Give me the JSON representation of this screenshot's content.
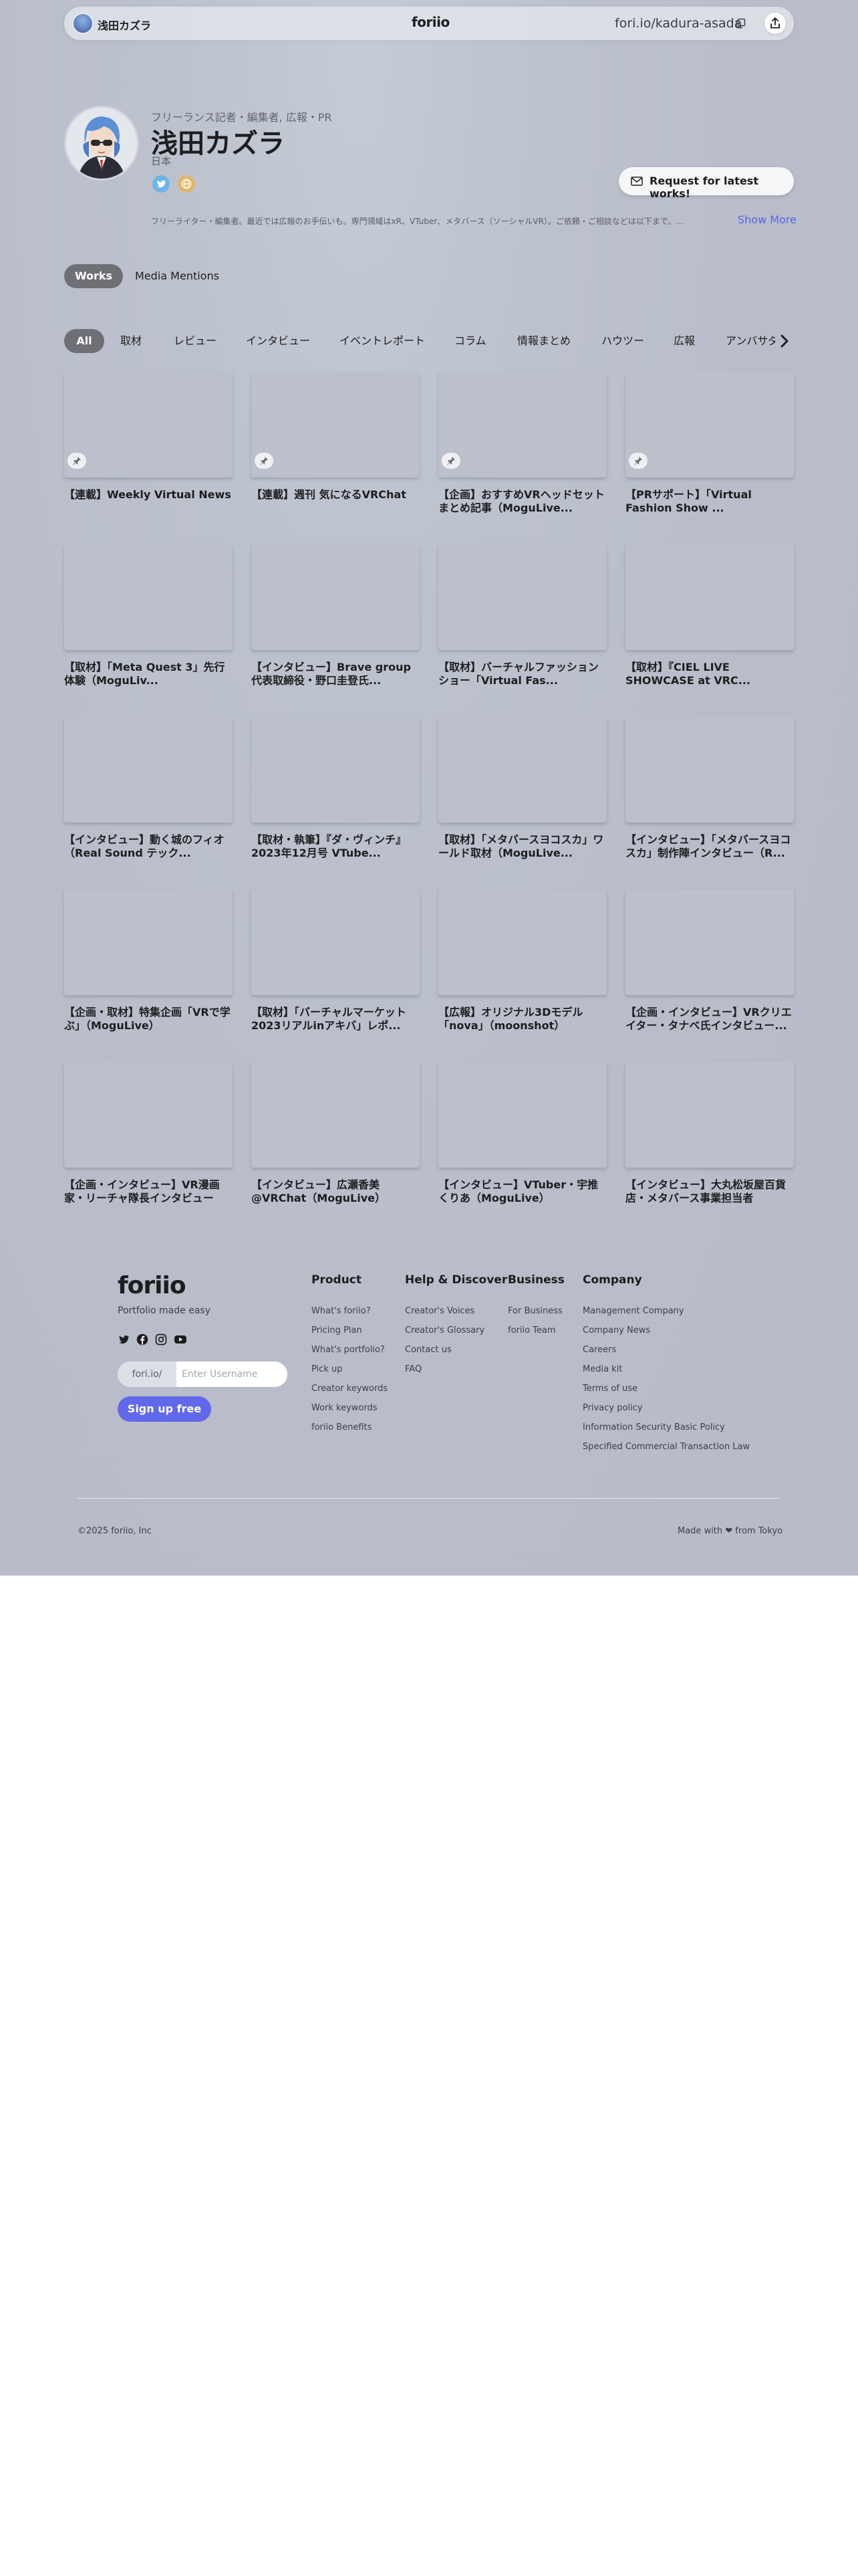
{
  "header": {
    "name": "浅田カズラ",
    "logo": "foriio",
    "url": "fori.io/kadura-asada",
    "copy_icon": "copy-icon",
    "share_icon": "share-icon"
  },
  "profile": {
    "occupation": "フリーランス記者・編集者, 広報・PR",
    "name": "浅田カズラ",
    "location": "日本",
    "socials": [
      "twitter-icon",
      "website-icon"
    ],
    "request_button": "Request for latest works!",
    "bio": "フリーライター・編集者。最近では広報のお手伝いも。専門領域はxR、VTuber、メタバース（ソーシャルVR）。ご依頼・ご相談などは以下まで。…",
    "show_more": "Show More"
  },
  "main_tabs": [
    {
      "label": "Works",
      "active": true
    },
    {
      "label": "Media Mentions",
      "active": false
    }
  ],
  "categories": [
    "All",
    "取材",
    "レビュー",
    "インタビュー",
    "イベントレポート",
    "コラム",
    "情報まとめ",
    "ハウツー",
    "広報",
    "アンバサダー"
  ],
  "works": [
    {
      "title": "【連載】Weekly Virtual News",
      "pinned": true
    },
    {
      "title": "【連載】週刊 気になるVRChat",
      "pinned": true
    },
    {
      "title": "【企画】おすすめVRヘッドセットまとめ記事（MoguLive...",
      "pinned": true
    },
    {
      "title": "【PRサポート】「Virtual Fashion Show ...",
      "pinned": true
    },
    {
      "title": "【取材】「Meta Quest 3」先行体験（MoguLiv...",
      "pinned": false
    },
    {
      "title": "【インタビュー】Brave group代表取締役・野口圭登氏...",
      "pinned": false
    },
    {
      "title": "【取材】バーチャルファッションショー「Virtual Fas...",
      "pinned": false
    },
    {
      "title": "【取材】『CIEL LIVE SHOWCASE at VRC...",
      "pinned": false
    },
    {
      "title": "【インタビュー】動く城のフィオ（Real Sound テック...",
      "pinned": false
    },
    {
      "title": "【取材・執筆】『ダ・ヴィンチ』2023年12月号 VTube...",
      "pinned": false
    },
    {
      "title": "【取材】「メタバースヨコスカ」ワールド取材（MoguLive...",
      "pinned": false
    },
    {
      "title": "【インタビュー】「メタバースヨコスカ」制作陣インタビュー（R...",
      "pinned": false
    },
    {
      "title": "【企画・取材】特集企画「VRで学ぶ」（MoguLive）",
      "pinned": false
    },
    {
      "title": "【取材】「バーチャルマーケット2023リアルinアキバ」レポ...",
      "pinned": false
    },
    {
      "title": "【広報】オリジナル3Dモデル「nova」（moonshot）",
      "pinned": false
    },
    {
      "title": "【企画・インタビュー】VRクリエイター・タナベ氏インタビュー...",
      "pinned": false
    },
    {
      "title": "【企画・インタビュー】VR漫画家・リーチャ隊長インタビュー（...",
      "pinned": false
    },
    {
      "title": "【インタビュー】広瀬香美@VRChat（MoguLive）",
      "pinned": false
    },
    {
      "title": "【インタビュー】VTuber・宇推くりあ（MoguLive）",
      "pinned": false
    },
    {
      "title": "【インタビュー】大丸松坂屋百貨店・メタバース事業担当者（Mo...",
      "pinned": false
    }
  ],
  "footer": {
    "logo": "foriio",
    "tagline": "Portfolio made easy",
    "social_icons": [
      "twitter-icon",
      "facebook-icon",
      "instagram-icon",
      "youtube-icon"
    ],
    "username_prefix": "fori.io/",
    "username_placeholder": "Enter Username",
    "signup": "Sign up free",
    "columns": [
      {
        "heading": "Product",
        "links": [
          "What's foriio?",
          "Pricing Plan",
          "What's portfolio?",
          "Pick up",
          "Creator keywords",
          "Work keywords",
          "foriio Benefits"
        ]
      },
      {
        "heading": "Help & Discover",
        "links": [
          "Creator's Voices",
          "Creator's Glossary",
          "Contact us",
          "FAQ"
        ]
      },
      {
        "heading": "Business",
        "links": [
          "For Business",
          "foriio Team"
        ]
      },
      {
        "heading": "Company",
        "links": [
          "Management Company",
          "Company News",
          "Careers",
          "Media kit",
          "Terms of use",
          "Privacy policy",
          "Information Security Basic Policy",
          "Specified Commercial Transaction Law"
        ]
      }
    ],
    "copyright": "©2025 foriio, Inc",
    "made_with": "Made with ❤ from Tokyo"
  },
  "colors": {
    "accent": "#5a63e8",
    "signup_button": "#6268ea",
    "active_tab": "#6e7076",
    "hero_background": "#b9bdc9"
  }
}
